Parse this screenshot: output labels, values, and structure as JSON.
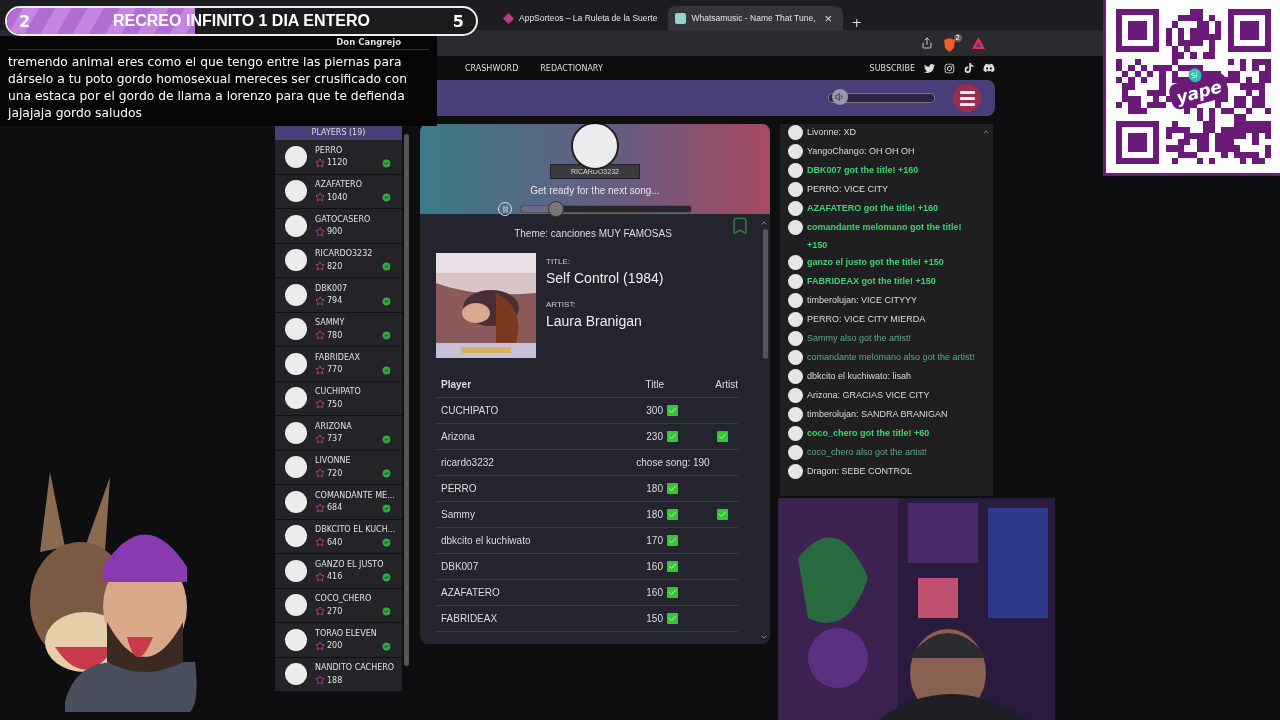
{
  "browser": {
    "tabs": [
      {
        "title": "AppSorteos – La Ruleta de la Suerte",
        "selected": false
      },
      {
        "title": "Whatsamusic - Name That Tune,",
        "selected": true
      }
    ],
    "close": "×",
    "new_tab": "+",
    "shield_badge": "2"
  },
  "site_nav": {
    "links": [
      "CRASHWORD",
      "REDACTIONARY"
    ],
    "subscribe": "SUBSCRIBE"
  },
  "volume": {
    "level": 0.1
  },
  "players": {
    "heading": "PLAYERS (19)",
    "items": [
      {
        "name": "PERRO",
        "score": "1120",
        "guessed": true
      },
      {
        "name": "AZAFATERO",
        "score": "1040",
        "guessed": true
      },
      {
        "name": "GATOCASERO",
        "score": "900",
        "guessed": false
      },
      {
        "name": "RICARDO3232",
        "score": "820",
        "guessed": true
      },
      {
        "name": "DBK007",
        "score": "794",
        "guessed": true
      },
      {
        "name": "SAMMY",
        "score": "780",
        "guessed": true
      },
      {
        "name": "FABRIDEAX",
        "score": "770",
        "guessed": true
      },
      {
        "name": "CUCHIPATO",
        "score": "750",
        "guessed": false
      },
      {
        "name": "ARIZONA",
        "score": "737",
        "guessed": true
      },
      {
        "name": "LIVONNE",
        "score": "720",
        "guessed": true
      },
      {
        "name": "COMANDANTE ME...",
        "score": "684",
        "guessed": true
      },
      {
        "name": "DBKCITO EL KUCH...",
        "score": "640",
        "guessed": true
      },
      {
        "name": "GANZO EL JUSTO",
        "score": "416",
        "guessed": true
      },
      {
        "name": "COCO_CHERO",
        "score": "270",
        "guessed": true
      },
      {
        "name": "TORAO ELEVEN",
        "score": "200",
        "guessed": true
      },
      {
        "name": "NANDITO CACHERO",
        "score": "188",
        "guessed": false
      }
    ]
  },
  "round": {
    "chooser": "RICARDO3232",
    "status": "Get ready for the next song...",
    "level": 0.2,
    "theme": "Theme: canciones MUY FAMOSAS",
    "title_label": "TITLE:",
    "title": "Self Control (1984)",
    "artist_label": "ARTIST:",
    "artist": "Laura Branigan"
  },
  "results": {
    "columns": [
      "Player",
      "Title",
      "Artist"
    ],
    "rows": [
      {
        "kind": "guess",
        "player": "CUCHIPATO",
        "score": "300",
        "title": true,
        "artist": false
      },
      {
        "kind": "guess",
        "player": "Arizona",
        "score": "230",
        "title": true,
        "artist": true
      },
      {
        "kind": "chooser",
        "player": "ricardo3232",
        "note": "chose song: 190"
      },
      {
        "kind": "guess",
        "player": "PERRO",
        "score": "180",
        "title": true,
        "artist": false
      },
      {
        "kind": "guess",
        "player": "Sammy",
        "score": "180",
        "title": true,
        "artist": true
      },
      {
        "kind": "guess",
        "player": "dbkcito el kuchiwato",
        "score": "170",
        "title": true,
        "artist": false
      },
      {
        "kind": "guess",
        "player": "DBK007",
        "score": "160",
        "title": true,
        "artist": false
      },
      {
        "kind": "guess",
        "player": "AZAFATERO",
        "score": "160",
        "title": true,
        "artist": false
      },
      {
        "kind": "guess",
        "player": "FABRIDEAX",
        "score": "150",
        "title": true,
        "artist": false
      }
    ]
  },
  "chat": [
    {
      "kind": "message",
      "text": "Livonne: XD"
    },
    {
      "kind": "message",
      "text": "YangoChango: OH OH OH"
    },
    {
      "kind": "title",
      "text": "DBK007 got the title! +160"
    },
    {
      "kind": "message",
      "text": "PERRO: VICE CITY"
    },
    {
      "kind": "title",
      "text": "AZAFATERO got the title! +160"
    },
    {
      "kind": "title",
      "text": "comandante melomano got the title! +150"
    },
    {
      "kind": "title",
      "text": "ganzo el justo got the title! +150"
    },
    {
      "kind": "title",
      "text": "FABRIDEAX got the title! +150"
    },
    {
      "kind": "message",
      "text": "timberolujan: VICE CITYYY"
    },
    {
      "kind": "message",
      "text": "PERRO: VICE CITY MIERDA"
    },
    {
      "kind": "artist",
      "text": "Sammy also got the artist!"
    },
    {
      "kind": "artist",
      "text": "comandante melomano also got the artist!"
    },
    {
      "kind": "message",
      "text": "dbkcito el kuchiwato: lisah"
    },
    {
      "kind": "message",
      "text": "Arizona: GRACIAS VICE CITY"
    },
    {
      "kind": "message",
      "text": "timberolujan: SANDRA BRANIGAN"
    },
    {
      "kind": "title",
      "text": "coco_chero got the title! +60"
    },
    {
      "kind": "artist",
      "text": "coco_chero also got the artist!"
    },
    {
      "kind": "message",
      "text": "Dragon: SEBE CONTROL"
    }
  ],
  "goal_banner": {
    "start": "2",
    "title": "RECREO INFINITO 1 DIA ENTERO",
    "end": "5",
    "user": "Don Cangrejo",
    "level": 0.4
  },
  "alert": {
    "message": "tremendo animal eres como el que tengo entre las piernas para dárselo a tu poto gordo homosexual mereces ser crusificado con una estaca por el gordo de llama a lorenzo para que te defienda jajajaja gordo saludos"
  },
  "qr": {
    "currency": "S/",
    "logo": "yape"
  }
}
